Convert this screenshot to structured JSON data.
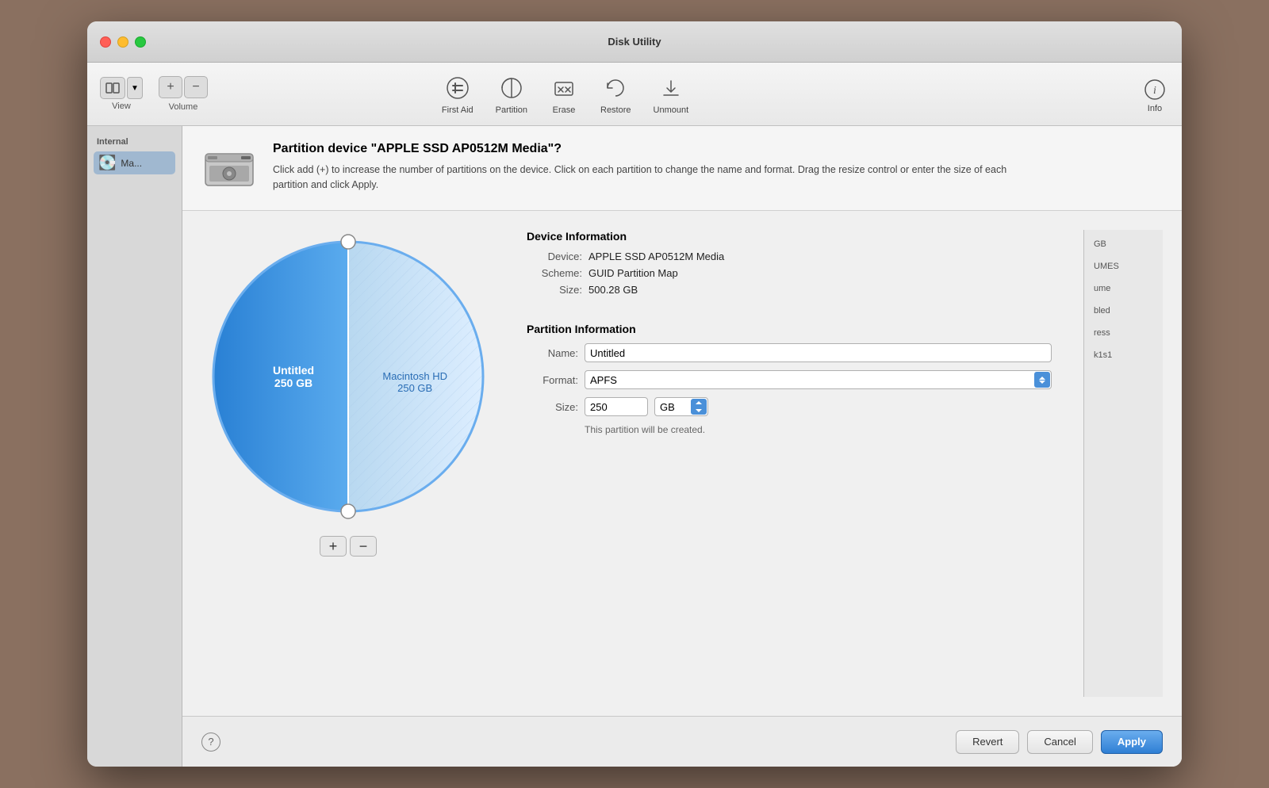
{
  "window": {
    "title": "Disk Utility"
  },
  "toolbar": {
    "view_label": "View",
    "volume_label": "Volume",
    "first_aid_label": "First Aid",
    "partition_label": "Partition",
    "erase_label": "Erase",
    "restore_label": "Restore",
    "unmount_label": "Unmount",
    "info_label": "Info"
  },
  "sidebar": {
    "section_label": "Internal",
    "items": [
      {
        "label": "Ma...",
        "icon": "💽"
      }
    ]
  },
  "dialog": {
    "title": "Partition device \"APPLE SSD AP0512M Media\"?",
    "description": "Click add (+) to increase the number of partitions on the device. Click on each partition to change the name and format. Drag the resize control or enter the size of each partition and click Apply.",
    "device_info": {
      "heading": "Device Information",
      "device_label": "Device:",
      "device_value": "APPLE SSD AP0512M Media",
      "scheme_label": "Scheme:",
      "scheme_value": "GUID Partition Map",
      "size_label": "Size:",
      "size_value": "500.28 GB"
    },
    "partition_info": {
      "heading": "Partition Information",
      "name_label": "Name:",
      "name_value": "Untitled",
      "format_label": "Format:",
      "format_value": "APFS",
      "size_label": "Size:",
      "size_value": "250",
      "size_unit": "GB",
      "note": "This partition will be created."
    },
    "pie": {
      "untitled_label": "Untitled",
      "untitled_size": "250 GB",
      "mac_label": "Macintosh HD",
      "mac_size": "250 GB"
    }
  },
  "footer": {
    "revert_label": "Revert",
    "cancel_label": "Cancel",
    "apply_label": "Apply"
  },
  "right_panel": {
    "items": [
      {
        "text": "GB"
      },
      {
        "text": "UMES"
      },
      {
        "text": "ume"
      },
      {
        "text": "bled"
      },
      {
        "text": "ress"
      },
      {
        "text": "k1s1"
      }
    ]
  }
}
